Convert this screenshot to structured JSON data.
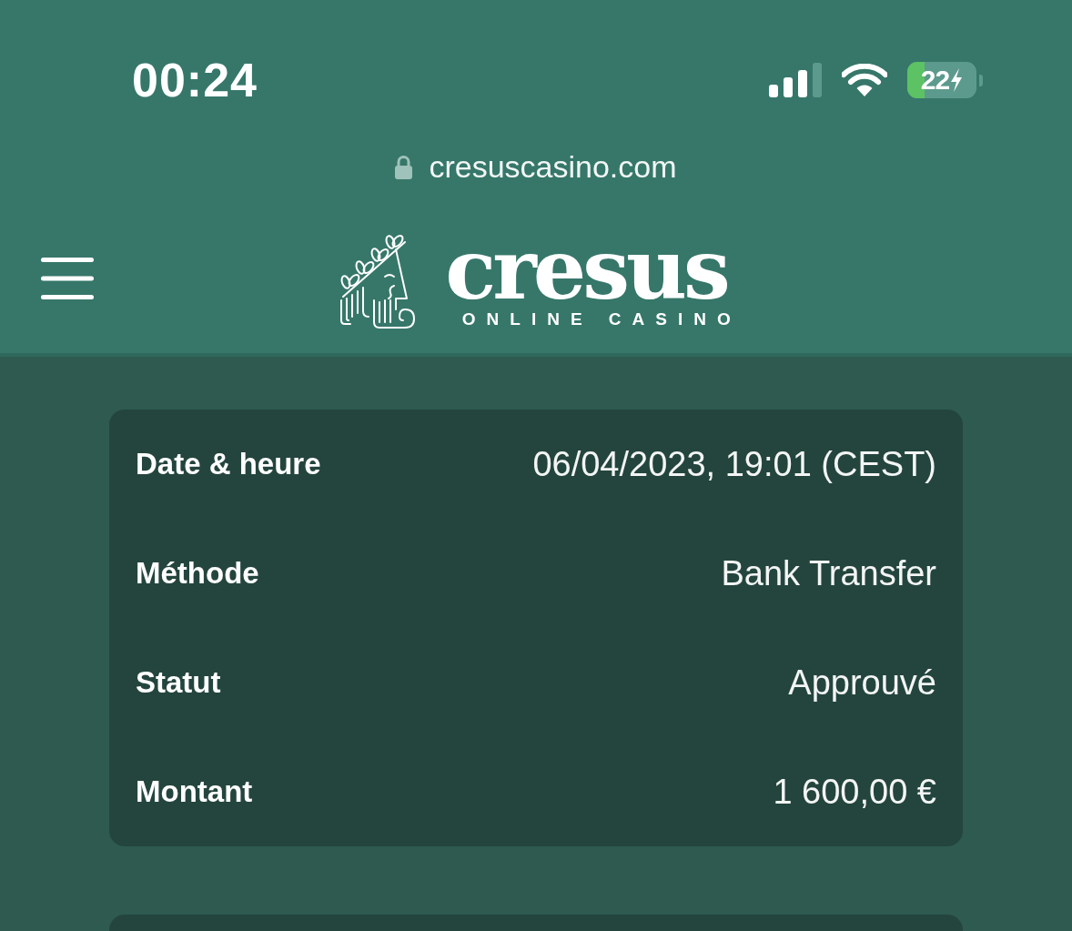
{
  "status_bar": {
    "time": "00:24",
    "battery": {
      "text": "22",
      "charging": true
    }
  },
  "browser": {
    "url": "cresuscasino.com",
    "secure": true
  },
  "header": {
    "logo": {
      "wordmark": "cresus",
      "tagline": "ONLINE CASINO"
    }
  },
  "transaction": {
    "rows": [
      {
        "label": "Date & heure",
        "value": "06/04/2023, 19:01 (CEST)"
      },
      {
        "label": "Méthode",
        "value": "Bank Transfer"
      },
      {
        "label": "Statut",
        "value": "Approuvé"
      },
      {
        "label": "Montant",
        "value": "1 600,00 €"
      }
    ]
  }
}
